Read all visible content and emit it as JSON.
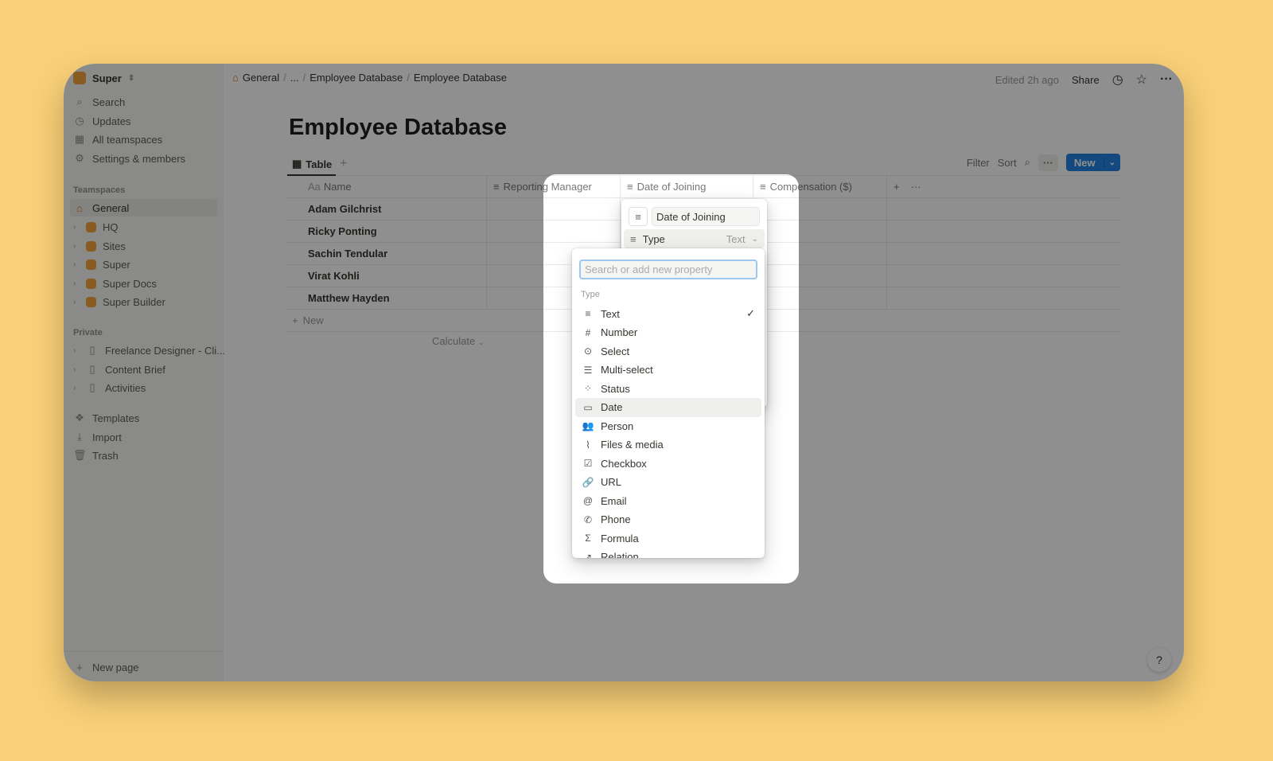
{
  "workspace": {
    "name": "Super",
    "icon": "lightning-icon"
  },
  "sidebar": {
    "nav": [
      {
        "label": "Search",
        "icon": "search-icon"
      },
      {
        "label": "Updates",
        "icon": "clock-icon"
      },
      {
        "label": "All teamspaces",
        "icon": "building-icon"
      },
      {
        "label": "Settings & members",
        "icon": "gear-icon"
      }
    ],
    "teamspaces_label": "Teamspaces",
    "teamspaces": [
      {
        "label": "General"
      },
      {
        "label": "HQ"
      },
      {
        "label": "Sites"
      },
      {
        "label": "Super"
      },
      {
        "label": "Super Docs"
      },
      {
        "label": "Super Builder"
      }
    ],
    "private_label": "Private",
    "private": [
      {
        "label": "Freelance Designer - Cli..."
      },
      {
        "label": "Content Brief"
      },
      {
        "label": "Activities"
      }
    ],
    "tools": [
      {
        "label": "Templates",
        "icon": "templates-icon"
      },
      {
        "label": "Import",
        "icon": "download-icon"
      },
      {
        "label": "Trash",
        "icon": "trash-icon"
      }
    ],
    "new_page": "New page"
  },
  "breadcrumb": [
    "General",
    "...",
    "Employee Database",
    "Employee Database"
  ],
  "topbar": {
    "edited": "Edited 2h ago",
    "share": "Share"
  },
  "page": {
    "title": "Employee Database"
  },
  "view": {
    "tab": "Table",
    "filter": "Filter",
    "sort": "Sort",
    "new": "New"
  },
  "table": {
    "columns": [
      "Name",
      "Reporting Manager",
      "Date of Joining",
      "Compensation ($)"
    ],
    "name_prefix": "Aa",
    "rows": [
      "Adam Gilchrist",
      "Ricky Ponting",
      "Sachin Tendular",
      "Virat Kohli",
      "Matthew Hayden"
    ],
    "new_row": "New",
    "calculate": "Calculate"
  },
  "property_editor": {
    "name_value": "Date of Joining",
    "type_label": "Type",
    "type_value": "Text"
  },
  "type_menu": {
    "placeholder": "Search or add new property",
    "section": "Type",
    "selected": "Text",
    "highlighted": "Date",
    "options": [
      {
        "label": "Text",
        "icon": "text-lines-icon"
      },
      {
        "label": "Number",
        "icon": "hash-icon"
      },
      {
        "label": "Select",
        "icon": "select-icon"
      },
      {
        "label": "Multi-select",
        "icon": "list-icon"
      },
      {
        "label": "Status",
        "icon": "status-icon"
      },
      {
        "label": "Date",
        "icon": "calendar-icon"
      },
      {
        "label": "Person",
        "icon": "people-icon"
      },
      {
        "label": "Files & media",
        "icon": "paperclip-icon"
      },
      {
        "label": "Checkbox",
        "icon": "checkbox-icon"
      },
      {
        "label": "URL",
        "icon": "link-icon"
      },
      {
        "label": "Email",
        "icon": "at-icon"
      },
      {
        "label": "Phone",
        "icon": "phone-icon"
      },
      {
        "label": "Formula",
        "icon": "sigma-icon"
      },
      {
        "label": "Relation",
        "icon": "arrow-up-right-icon"
      }
    ]
  },
  "help": "?"
}
